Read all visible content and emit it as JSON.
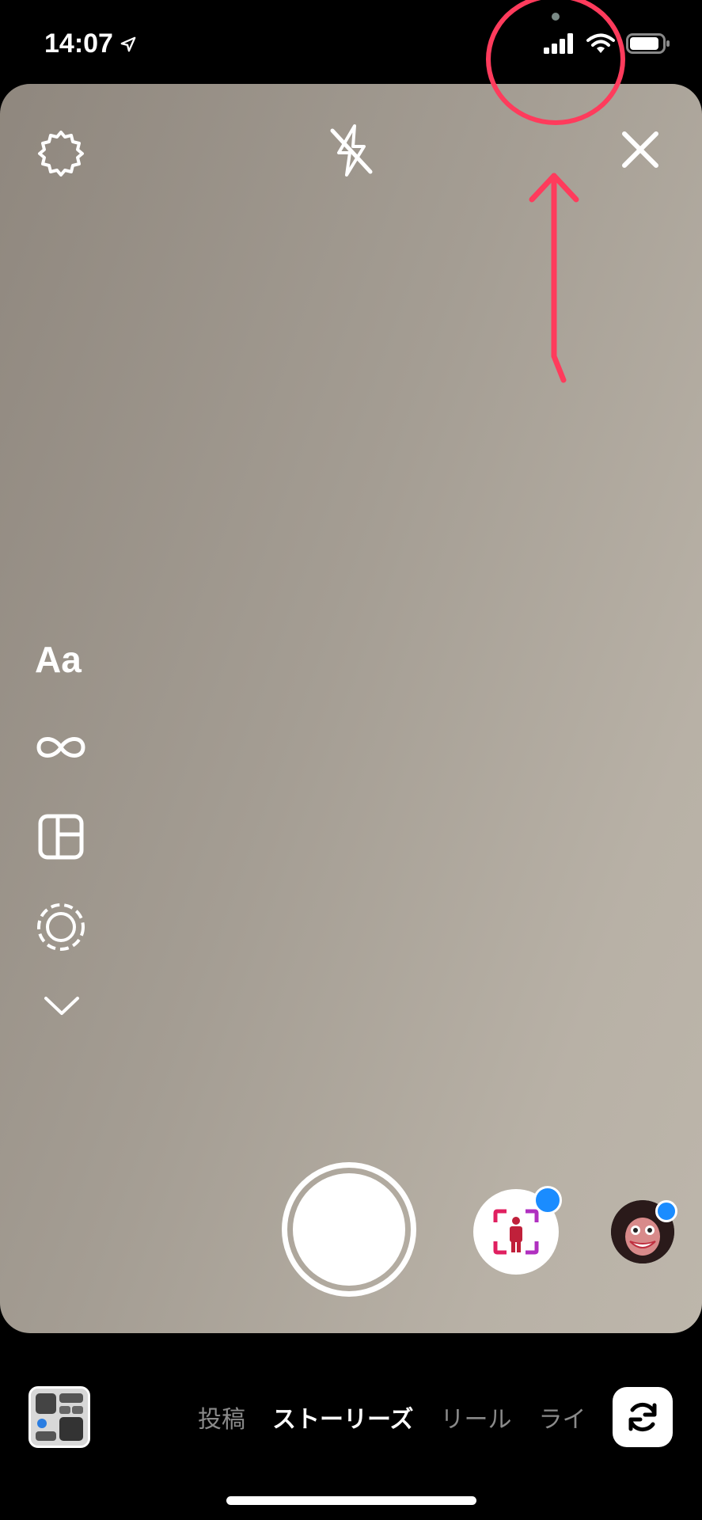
{
  "status_bar": {
    "time": "14:07",
    "icons": [
      "location-arrow-icon",
      "cellular-signal-icon",
      "wifi-icon",
      "battery-icon"
    ]
  },
  "camera_top_bar": {
    "icons": [
      "settings-gear-icon",
      "flash-off-icon",
      "close-icon"
    ]
  },
  "tools": {
    "text_label": "Aa",
    "icons": [
      "boomerang-infinity-icon",
      "layout-grid-icon",
      "dashed-circle-icon",
      "chevron-down-icon"
    ]
  },
  "capture": {
    "effects": [
      "person-frame-effect-icon",
      "face-effect-avatar"
    ]
  },
  "mode_selector": {
    "modes": [
      "投稿",
      "ストーリーズ",
      "リール",
      "ライ"
    ],
    "active": "ストーリーズ"
  },
  "colors": {
    "annotation": "#ff3b5c",
    "badge": "#1a8cff"
  }
}
